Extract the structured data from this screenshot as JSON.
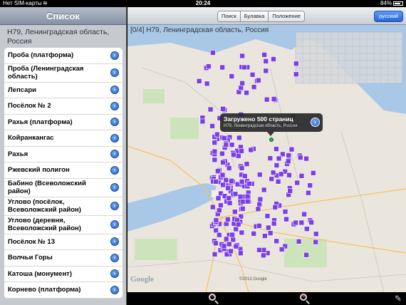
{
  "status_bar": {
    "carrier": "Нет SIM-карты",
    "time": "20:24",
    "battery": "84%",
    "battery_level": 0.84
  },
  "sidebar": {
    "header": "Список",
    "location_title": "H79, Ленинградская область, Россия",
    "items": [
      {
        "label": "Проба (платформа)"
      },
      {
        "label": "Проба (Ленинградская область)"
      },
      {
        "label": "Лепсари"
      },
      {
        "label": "Посёлок № 2"
      },
      {
        "label": "Рахья (платформа)"
      },
      {
        "label": "Койранкангас"
      },
      {
        "label": "Рахья"
      },
      {
        "label": "Ржевский полигон"
      },
      {
        "label": "Бабино (Всеволожский район)"
      },
      {
        "label": "Углово (посёлок, Всеволожский район)"
      },
      {
        "label": "Углово (деревня, Всеволожский район)"
      },
      {
        "label": "Посёлок № 13"
      },
      {
        "label": "Волчьи Горы"
      },
      {
        "label": "Катоша (монумент)"
      },
      {
        "label": "Корнево (платформа)"
      }
    ]
  },
  "toolbar": {
    "segments": [
      "Поиск",
      "Булавка",
      "Положение"
    ],
    "language_button": "русский"
  },
  "map": {
    "title": "[0/4] H79, Ленинградская область, Россия",
    "callout_title": "Загружено 500 страниц",
    "callout_subtitle": "H79, Ленинградская область, Россия",
    "google_logo": "Google",
    "copyright": "©2013 Google",
    "marker_color": "#7b3fe4",
    "water_color": "#a9c8e8",
    "land_color": "#eae6de"
  }
}
